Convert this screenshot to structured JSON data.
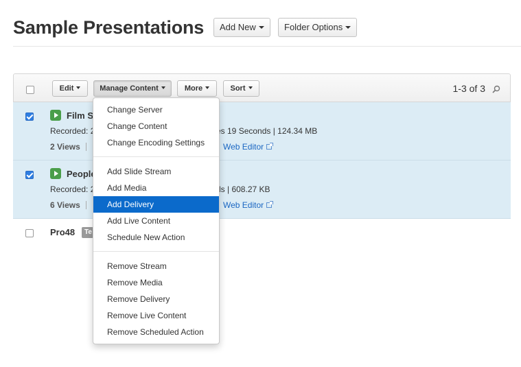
{
  "header": {
    "title": "Sample Presentations",
    "add_new_label": "Add New",
    "folder_options_label": "Folder Options"
  },
  "toolbar": {
    "edit_label": "Edit",
    "manage_content_label": "Manage Content",
    "more_label": "More",
    "sort_label": "Sort",
    "count": "1-3 of 3"
  },
  "rows": [
    {
      "title": "Film Sa",
      "recorded": "Recorded: 2",
      "recorded_tail": "es 19 Seconds | 124.34 MB",
      "views": "2 Views",
      "link": "Web Editor",
      "checked": true
    },
    {
      "title": "People",
      "recorded": "Recorded: 2",
      "recorded_tail": "ds | 608.27 KB",
      "views": "6 Views",
      "link": "Web Editor",
      "checked": true
    },
    {
      "title": "Pro48",
      "tag": "Te",
      "checked": false
    }
  ],
  "menu": {
    "group1": [
      "Change Server",
      "Change Content",
      "Change Encoding Settings"
    ],
    "group2": [
      "Add Slide Stream",
      "Add Media",
      "Add Delivery",
      "Add Live Content",
      "Schedule New Action"
    ],
    "group3": [
      "Remove Stream",
      "Remove Media",
      "Remove Delivery",
      "Remove Live Content",
      "Remove Scheduled Action"
    ],
    "highlighted": "Add Delivery"
  },
  "colors": {
    "selected_row": "#dcecf5",
    "menu_highlight": "#0b6acb",
    "link": "#1a66c2",
    "play_icon": "#4a9e4a"
  }
}
